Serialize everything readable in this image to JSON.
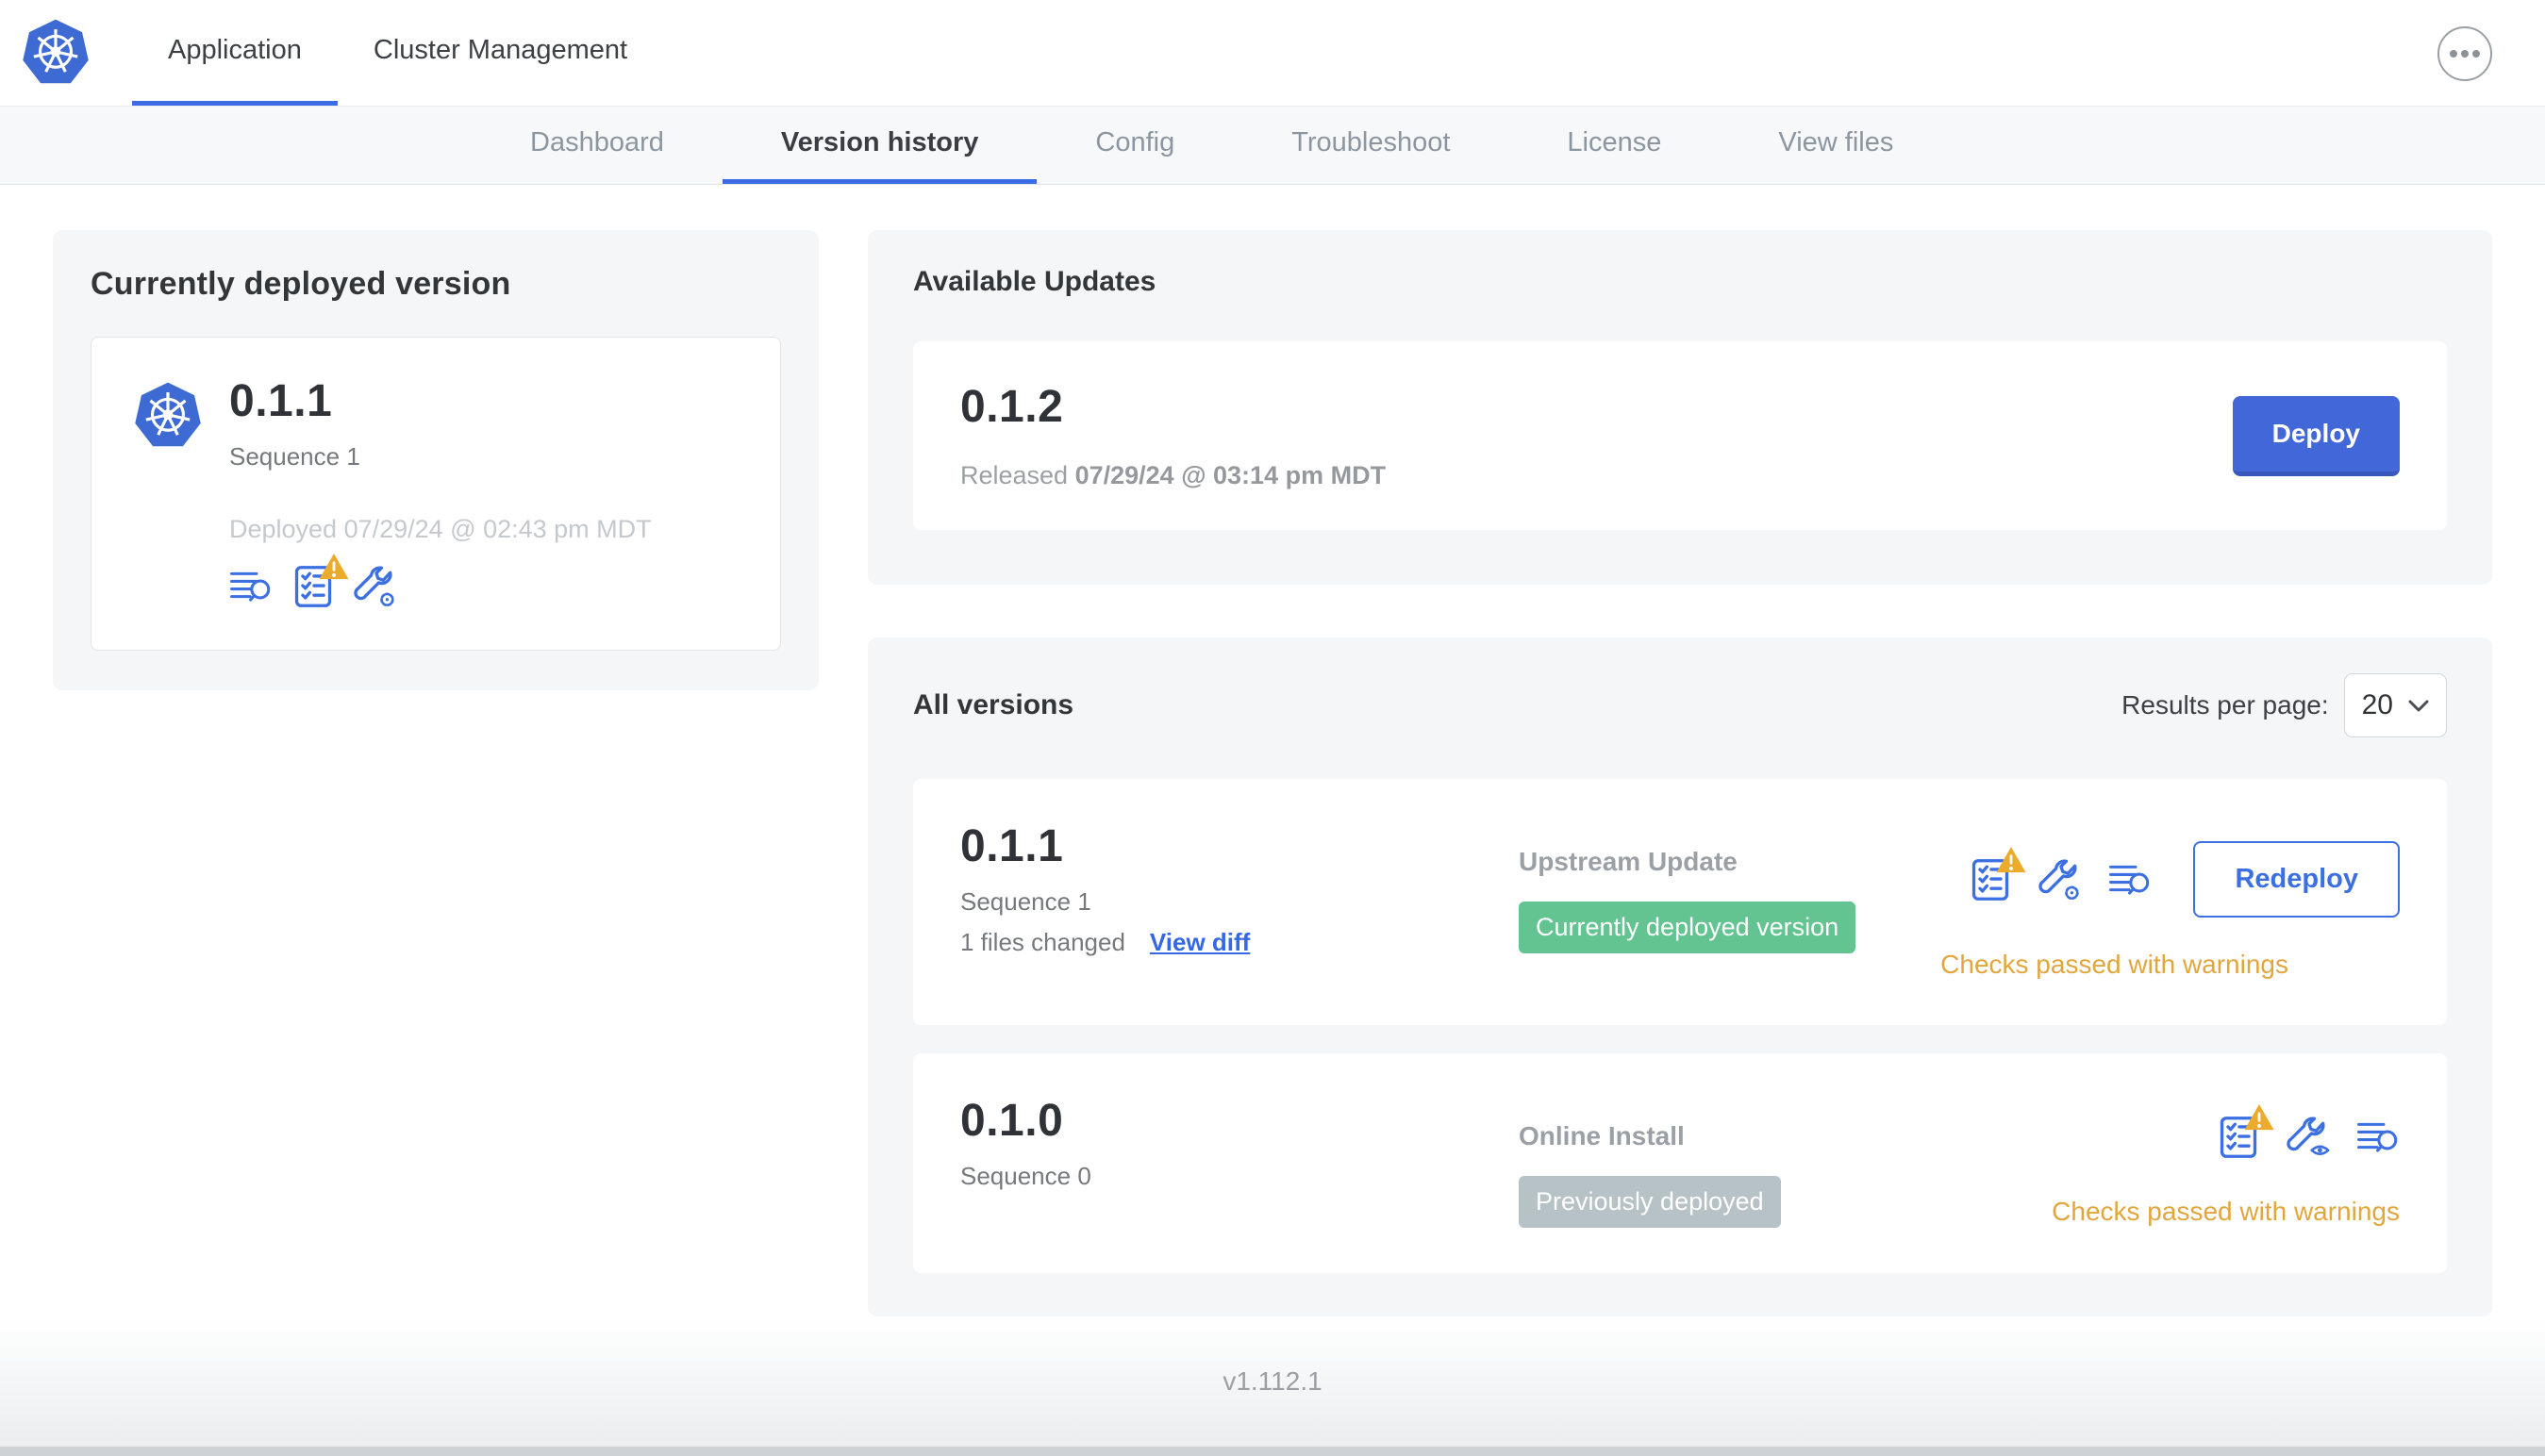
{
  "header": {
    "tabs": [
      {
        "label": "Application",
        "active": true
      },
      {
        "label": "Cluster Management",
        "active": false
      }
    ]
  },
  "subnav": {
    "tabs": [
      "Dashboard",
      "Version history",
      "Config",
      "Troubleshoot",
      "License",
      "View files"
    ],
    "active": "Version history"
  },
  "current_version": {
    "title": "Currently deployed version",
    "version": "0.1.1",
    "sequence": "Sequence 1",
    "deployed": "Deployed 07/29/24 @ 02:43 pm MDT"
  },
  "available_updates": {
    "title": "Available Updates",
    "version": "0.1.2",
    "released_label": "Released",
    "released_date": "07/29/24 @ 03:14 pm MDT",
    "deploy_label": "Deploy"
  },
  "all_versions": {
    "title": "All versions",
    "results_per_page_label": "Results per page:",
    "results_per_page_value": "20",
    "rows": [
      {
        "version": "0.1.1",
        "sequence": "Sequence 1",
        "files_changed": "1 files changed",
        "view_diff_label": "View diff",
        "source": "Upstream Update",
        "badge": "Currently deployed version",
        "badge_color": "#63c492",
        "action_label": "Redeploy",
        "status": "Checks passed with warnings"
      },
      {
        "version": "0.1.0",
        "sequence": "Sequence 0",
        "source": "Online Install",
        "badge": "Previously deployed",
        "badge_color": "#b7c2c6",
        "status": "Checks passed with warnings"
      }
    ]
  },
  "footer": {
    "app_version": "v1.112.1"
  },
  "colors": {
    "accent_blue": "#3b6ce5",
    "icon_blue": "#3b6fe2",
    "deploy_button": "#4267d9",
    "badge_green": "#63c492",
    "badge_gray": "#b7c2c6",
    "warning_amber": "#e2a63d",
    "warning_triangle": "#edab2d",
    "kubernetes_blue": "#3e6ad3",
    "section_bg": "#f4f6f8"
  }
}
